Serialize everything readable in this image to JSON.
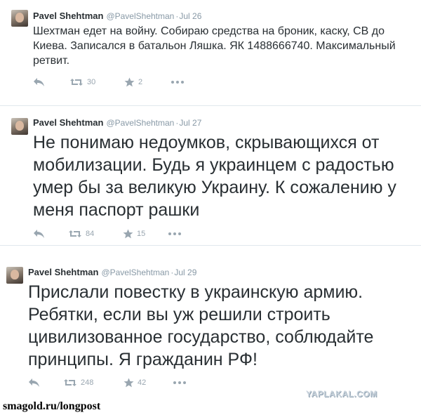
{
  "tweets": [
    {
      "name": "Pavel Shehtman",
      "handle": "@PavelShehtman",
      "separator": "·",
      "date": "Jul 26",
      "text": "Шехтман едет на войну. Собираю средства на броник, каску, СВ до Киева. Записался в батальон Ляшка. ЯК 1488666740. Максимальный ретвит.",
      "retweets": "30",
      "favorites": "2"
    },
    {
      "name": "Pavel Shehtman",
      "handle": "@PavelShehtman",
      "separator": "·",
      "date": "Jul 27",
      "text": "Не понимаю недоумков, скрывающихся от мобилизации. Будь я украинцем с радостью умер бы за великую Украину. К сожалению у меня паспорт рашки",
      "retweets": "84",
      "favorites": "15"
    },
    {
      "name": "Pavel Shehtman",
      "handle": "@PavelShehtman",
      "separator": "·",
      "date": "Jul 29",
      "text": "Прислали повестку в украинскую армию. Ребятки, если вы уж решили строить цивилизованное государство, соблюдайте принципы. Я гражданин РФ!",
      "retweets": "248",
      "favorites": "42"
    }
  ],
  "watermark": "YAPLAKAL.COM",
  "footer": "smagold.ru/longpost",
  "icons": {
    "reply": "reply-icon",
    "retweet": "retweet-icon",
    "favorite": "star-icon",
    "more": "more-icon"
  },
  "colors": {
    "text": "#292f33",
    "muted": "#8899a6",
    "icons": "#99a6b0",
    "divider": "#e1e8ed"
  }
}
